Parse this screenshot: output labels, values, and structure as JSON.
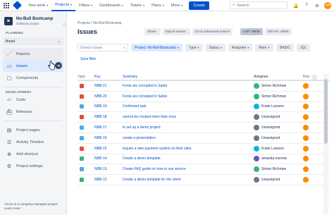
{
  "topnav": {
    "menu": [
      {
        "label": "Your work",
        "caret": true,
        "active": false
      },
      {
        "label": "Projects",
        "caret": true,
        "active": true
      },
      {
        "label": "Filters",
        "caret": true,
        "active": false
      },
      {
        "label": "Dashboards",
        "caret": true,
        "active": false
      },
      {
        "label": "Teams",
        "caret": true,
        "active": false
      },
      {
        "label": "Plans",
        "caret": true,
        "active": false
      },
      {
        "label": "More",
        "caret": true,
        "active": false
      }
    ],
    "create_label": "Create",
    "search_placeholder": "Search",
    "avatar_initials": "SR"
  },
  "sidebar": {
    "project_name": "No-Bull Bootcamp",
    "project_type": "Software project",
    "planning_label": "PLANNING",
    "board_label": "Board",
    "planning_items": [
      {
        "label": "Reports",
        "icon": "reports-icon"
      },
      {
        "label": "Issues",
        "icon": "issues-icon"
      },
      {
        "label": "Components",
        "icon": "components-icon"
      }
    ],
    "development_label": "DEVELOPMENT",
    "development_items": [
      {
        "label": "Code",
        "icon": "code-icon"
      },
      {
        "label": "Releases",
        "icon": "releases-icon"
      }
    ],
    "other_items": [
      {
        "label": "Project pages",
        "icon": "pages-icon"
      },
      {
        "label": "Activity Timeline",
        "icon": "timeline-icon"
      },
      {
        "label": "Add shortcut",
        "icon": "add-shortcut-icon"
      },
      {
        "label": "Project settings",
        "icon": "settings-icon"
      }
    ],
    "footer_line1": "You're in a company-managed project",
    "footer_line2": "Learn more"
  },
  "main": {
    "breadcrumb": "Projects  /  No-Bull Bootcamp",
    "title": "Issues",
    "actions": [
      "Share",
      "Export issues",
      "Go to advanced search",
      "LIST VIEW",
      "DETAIL VIEW"
    ],
    "filter_search_placeholder": "Search issues",
    "filters": [
      {
        "label": "Project: No-Bull Bootcamp",
        "style": "blue"
      },
      {
        "label": "Type",
        "style": "grey"
      },
      {
        "label": "Status",
        "style": "grey"
      },
      {
        "label": "Assignee",
        "style": "grey"
      },
      {
        "label": "More +",
        "style": "grey"
      },
      {
        "label": "BASIC",
        "style": "grey"
      },
      {
        "label": "JQL",
        "style": "grey"
      }
    ],
    "save_filter": "Save filter",
    "columns": [
      "Type",
      "Key",
      "Summary",
      "Assignee",
      "Rep"
    ],
    "rows": [
      {
        "type_color": "#e5493a",
        "key": "NBB-21",
        "summary": "Fonts are corrupted in Safari",
        "assignee": "Simon Richman",
        "av_color": "#36b37e",
        "rep_color": "#ff8b00"
      },
      {
        "type_color": "#e5493a",
        "key": "NBB-20",
        "summary": "Fonts are corrupted in Safari",
        "assignee": "Simon Richman",
        "av_color": "#36b37e",
        "rep_color": "#ff8b00"
      },
      {
        "type_color": "#4bade8",
        "key": "NBB-19",
        "summary": "Confirmed task",
        "assignee": "Frank Larsson",
        "av_color": "#00b8d9",
        "rep_color": "#ff8b00"
      },
      {
        "type_color": "#e5493a",
        "key": "NBB-18",
        "summary": "cannot be created more than once",
        "assignee": "Unassigned",
        "av_color": "#6b778c",
        "rep_color": "#ff8b00"
      },
      {
        "type_color": "#4bade8",
        "key": "NBB-17",
        "summary": "to set up a demo project",
        "assignee": "Unassigned",
        "av_color": "#6b778c",
        "rep_color": "#ff8b00"
      },
      {
        "type_color": "#4bade8",
        "key": "NBB-16",
        "summary": "create a presentation",
        "assignee": "Unassigned",
        "av_color": "#6b778c",
        "rep_color": "#ff8b00"
      },
      {
        "type_color": "#e5493a",
        "key": "NBB-15",
        "summary": "Inquire a new payment system on their sites",
        "assignee": "Frank Larsson",
        "av_color": "#00b8d9",
        "rep_color": "#ff8b00"
      },
      {
        "type_color": "#36b37e",
        "key": "NBB-14",
        "summary": "Create a demo template",
        "assignee": "amanda.morrow",
        "av_color": "#6554c0",
        "rep_color": "#ff8b00"
      },
      {
        "type_color": "#4bade8",
        "key": "NBB-13",
        "summary": "Create FAQ guide on how to use service",
        "assignee": "Simon Richman",
        "av_color": "#36b37e",
        "rep_color": "#ff8b00"
      },
      {
        "type_color": "#36b37e",
        "key": "NBB-12",
        "summary": "Create a demo template for the client",
        "assignee": "Unassigned",
        "av_color": "#6b778c",
        "rep_color": "#ff8b00"
      }
    ]
  }
}
